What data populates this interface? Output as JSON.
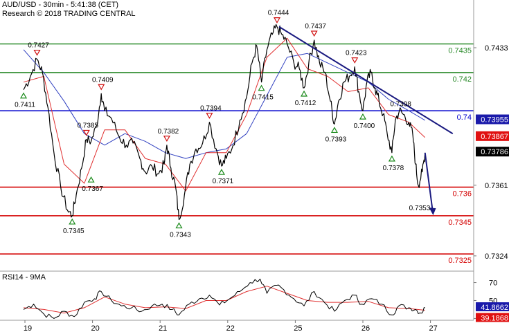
{
  "header": {
    "title": "AUD/USD - 30min - 5:41:38 (CET)",
    "subtitle": "Research © 2018 TRADING CENTRAL"
  },
  "colors": {
    "price": "#000000",
    "support": "#d40000",
    "resistance": "#2a8a2a",
    "pivot": "#0000cc",
    "trendline": "#1a1a80",
    "ma_fast": "#e03030",
    "ma_slow": "#3040c0",
    "rsi": "#000000",
    "rsi_ma": "#e03030",
    "up_marker": "#1a8a1a",
    "down_marker": "#d01010"
  },
  "chart_data": [
    {
      "type": "line",
      "title": "AUD/USD - 30min - 5:41:38 (CET)",
      "ylim": [
        0.7316,
        0.7458
      ],
      "x_ticks": [
        "19",
        "20",
        "21",
        "22",
        "25",
        "26",
        "27"
      ],
      "y_ticks": [
        0.7433,
        0.7361,
        0.7324
      ],
      "last_price": 0.73786,
      "price_labels": [
        {
          "value": 0.73955,
          "color": "#1a1aaa"
        },
        {
          "value": 0.73867,
          "color": "#e01010"
        },
        {
          "value": 0.73786,
          "color": "#000000"
        }
      ],
      "levels": [
        {
          "value": 0.7435,
          "label": "0.7435",
          "kind": "resistance"
        },
        {
          "value": 0.742,
          "label": "0.742",
          "kind": "resistance"
        },
        {
          "value": 0.74,
          "label": "0.74",
          "kind": "pivot"
        },
        {
          "value": 0.736,
          "label": "0.736",
          "kind": "support"
        },
        {
          "value": 0.7345,
          "label": "0.7345",
          "kind": "support"
        },
        {
          "value": 0.7325,
          "label": "0.7325",
          "kind": "support"
        }
      ],
      "price_series": [
        [
          0.0,
          0.7411
        ],
        [
          0.1,
          0.7418
        ],
        [
          0.2,
          0.7427
        ],
        [
          0.28,
          0.742
        ],
        [
          0.36,
          0.7402
        ],
        [
          0.45,
          0.7378
        ],
        [
          0.55,
          0.736
        ],
        [
          0.65,
          0.7348
        ],
        [
          0.72,
          0.7345
        ],
        [
          0.78,
          0.7356
        ],
        [
          0.86,
          0.737
        ],
        [
          0.93,
          0.7385
        ],
        [
          1.0,
          0.7384
        ],
        [
          1.08,
          0.7392
        ],
        [
          1.15,
          0.7409
        ],
        [
          1.2,
          0.74
        ],
        [
          1.3,
          0.7396
        ],
        [
          1.42,
          0.7386
        ],
        [
          1.52,
          0.7382
        ],
        [
          1.62,
          0.7383
        ],
        [
          1.72,
          0.7375
        ],
        [
          1.8,
          0.7368
        ],
        [
          1.9,
          0.7371
        ],
        [
          2.0,
          0.7367
        ],
        [
          2.08,
          0.7372
        ],
        [
          2.12,
          0.7382
        ],
        [
          2.18,
          0.737
        ],
        [
          2.25,
          0.736
        ],
        [
          2.3,
          0.7343
        ],
        [
          2.38,
          0.7356
        ],
        [
          2.46,
          0.7372
        ],
        [
          2.55,
          0.738
        ],
        [
          2.65,
          0.7383
        ],
        [
          2.75,
          0.7394
        ],
        [
          2.85,
          0.738
        ],
        [
          2.93,
          0.7371
        ],
        [
          3.0,
          0.7375
        ],
        [
          3.1,
          0.7382
        ],
        [
          3.2,
          0.7395
        ],
        [
          3.3,
          0.7407
        ],
        [
          3.38,
          0.7425
        ],
        [
          3.45,
          0.7434
        ],
        [
          3.52,
          0.7415
        ],
        [
          3.6,
          0.7432
        ],
        [
          3.68,
          0.744
        ],
        [
          3.75,
          0.7444
        ],
        [
          3.82,
          0.744
        ],
        [
          3.9,
          0.7435
        ],
        [
          4.0,
          0.7425
        ],
        [
          4.08,
          0.7422
        ],
        [
          4.15,
          0.7412
        ],
        [
          4.22,
          0.7425
        ],
        [
          4.3,
          0.7437
        ],
        [
          4.38,
          0.7425
        ],
        [
          4.46,
          0.742
        ],
        [
          4.54,
          0.7405
        ],
        [
          4.6,
          0.7393
        ],
        [
          4.66,
          0.7405
        ],
        [
          4.74,
          0.7415
        ],
        [
          4.82,
          0.7418
        ],
        [
          4.9,
          0.7423
        ],
        [
          4.96,
          0.741
        ],
        [
          5.02,
          0.74
        ],
        [
          5.08,
          0.7415
        ],
        [
          5.14,
          0.742
        ],
        [
          5.2,
          0.7412
        ],
        [
          5.26,
          0.7405
        ],
        [
          5.32,
          0.7398
        ],
        [
          5.38,
          0.7388
        ],
        [
          5.45,
          0.7378
        ],
        [
          5.5,
          0.7395
        ],
        [
          5.56,
          0.74
        ],
        [
          5.62,
          0.7398
        ],
        [
          5.7,
          0.7394
        ],
        [
          5.76,
          0.7387
        ],
        [
          5.8,
          0.7372
        ],
        [
          5.84,
          0.7361
        ],
        [
          5.9,
          0.7368
        ],
        [
          5.94,
          0.7378
        ]
      ],
      "ma_fast": [
        [
          0.0,
          0.7415
        ],
        [
          0.3,
          0.7418
        ],
        [
          0.6,
          0.7372
        ],
        [
          0.9,
          0.7362
        ],
        [
          1.2,
          0.739
        ],
        [
          1.5,
          0.739
        ],
        [
          1.8,
          0.7375
        ],
        [
          2.1,
          0.7372
        ],
        [
          2.4,
          0.7358
        ],
        [
          2.7,
          0.7378
        ],
        [
          3.0,
          0.7378
        ],
        [
          3.3,
          0.7398
        ],
        [
          3.6,
          0.7428
        ],
        [
          3.9,
          0.7438
        ],
        [
          4.2,
          0.7422
        ],
        [
          4.5,
          0.7418
        ],
        [
          4.8,
          0.741
        ],
        [
          5.1,
          0.7412
        ],
        [
          5.4,
          0.7398
        ],
        [
          5.7,
          0.7394
        ],
        [
          5.94,
          0.7386
        ]
      ],
      "ma_slow": [
        [
          0.0,
          0.7432
        ],
        [
          0.3,
          0.742
        ],
        [
          0.6,
          0.7405
        ],
        [
          0.9,
          0.7388
        ],
        [
          1.2,
          0.7382
        ],
        [
          1.5,
          0.7388
        ],
        [
          1.8,
          0.7384
        ],
        [
          2.1,
          0.7378
        ],
        [
          2.4,
          0.7375
        ],
        [
          2.7,
          0.7378
        ],
        [
          3.0,
          0.738
        ],
        [
          3.3,
          0.7388
        ],
        [
          3.6,
          0.7408
        ],
        [
          3.9,
          0.7428
        ],
        [
          4.2,
          0.743
        ],
        [
          4.5,
          0.7425
        ],
        [
          4.8,
          0.742
        ],
        [
          5.1,
          0.7415
        ],
        [
          5.4,
          0.7406
        ],
        [
          5.7,
          0.74
        ],
        [
          5.94,
          0.7395
        ]
      ],
      "trendline": [
        [
          3.78,
          0.7444
        ],
        [
          6.35,
          0.7388
        ]
      ],
      "projection": [
        [
          5.94,
          0.7378
        ],
        [
          6.05,
          0.7346
        ]
      ],
      "markers": [
        {
          "x": 0.0,
          "value": 0.7411,
          "label": "0.7411",
          "dir": "up"
        },
        {
          "x": 0.2,
          "value": 0.7427,
          "label": "0.7427",
          "dir": "down"
        },
        {
          "x": 0.72,
          "value": 0.7345,
          "label": "0.7345",
          "dir": "up"
        },
        {
          "x": 0.93,
          "value": 0.7385,
          "label": "0.7385",
          "dir": "down"
        },
        {
          "x": 1.15,
          "value": 0.7409,
          "label": "0.7409",
          "dir": "down"
        },
        {
          "x": 1.0,
          "value": 0.7367,
          "label": "0.7367",
          "dir": "up"
        },
        {
          "x": 2.12,
          "value": 0.7382,
          "label": "0.7382",
          "dir": "down"
        },
        {
          "x": 2.3,
          "value": 0.7343,
          "label": "0.7343",
          "dir": "up"
        },
        {
          "x": 2.75,
          "value": 0.7394,
          "label": "0.7394",
          "dir": "down"
        },
        {
          "x": 2.93,
          "value": 0.7371,
          "label": "0.7371",
          "dir": "up"
        },
        {
          "x": 3.52,
          "value": 0.7415,
          "label": "0.7415",
          "dir": "up"
        },
        {
          "x": 3.75,
          "value": 0.7444,
          "label": "0.7444",
          "dir": "down"
        },
        {
          "x": 4.15,
          "value": 0.7412,
          "label": "0.7412",
          "dir": "up"
        },
        {
          "x": 4.3,
          "value": 0.7437,
          "label": "0.7437",
          "dir": "down"
        },
        {
          "x": 4.6,
          "value": 0.7393,
          "label": "0.7393",
          "dir": "up"
        },
        {
          "x": 4.9,
          "value": 0.7423,
          "label": "0.7423",
          "dir": "down"
        },
        {
          "x": 5.02,
          "value": 0.74,
          "label": "0.7400",
          "dir": "up"
        },
        {
          "x": 5.45,
          "value": 0.7378,
          "label": "0.7378",
          "dir": "up"
        },
        {
          "x": 5.56,
          "value": 0.7398,
          "label": "0.7398",
          "dir": "none"
        },
        {
          "x": 5.84,
          "value": 0.7353,
          "label": "0.7353",
          "dir": "none"
        }
      ]
    },
    {
      "type": "line",
      "title": "RSI14 - 9MA",
      "ylim": [
        28,
        82
      ],
      "y_ticks": [
        70,
        50,
        30
      ],
      "last_values": {
        "rsi": "41.8662",
        "ma": "39.1868"
      },
      "rsi_series": [
        [
          0.0,
          40
        ],
        [
          0.15,
          46
        ],
        [
          0.3,
          35
        ],
        [
          0.45,
          30
        ],
        [
          0.6,
          38
        ],
        [
          0.75,
          32
        ],
        [
          0.9,
          48
        ],
        [
          1.05,
          52
        ],
        [
          1.15,
          60
        ],
        [
          1.3,
          50
        ],
        [
          1.45,
          44
        ],
        [
          1.6,
          42
        ],
        [
          1.75,
          38
        ],
        [
          1.9,
          44
        ],
        [
          2.05,
          46
        ],
        [
          2.2,
          40
        ],
        [
          2.3,
          34
        ],
        [
          2.45,
          46
        ],
        [
          2.6,
          52
        ],
        [
          2.75,
          56
        ],
        [
          2.9,
          45
        ],
        [
          3.05,
          52
        ],
        [
          3.2,
          60
        ],
        [
          3.35,
          70
        ],
        [
          3.5,
          74
        ],
        [
          3.6,
          58
        ],
        [
          3.75,
          67
        ],
        [
          3.85,
          62
        ],
        [
          4.0,
          52
        ],
        [
          4.15,
          44
        ],
        [
          4.3,
          60
        ],
        [
          4.45,
          48
        ],
        [
          4.6,
          38
        ],
        [
          4.75,
          50
        ],
        [
          4.9,
          56
        ],
        [
          5.0,
          46
        ],
        [
          5.15,
          52
        ],
        [
          5.3,
          46
        ],
        [
          5.45,
          34
        ],
        [
          5.55,
          44
        ],
        [
          5.7,
          42
        ],
        [
          5.8,
          40
        ],
        [
          5.88,
          36
        ],
        [
          5.94,
          41.9
        ]
      ],
      "rsi_ma": [
        [
          0.0,
          42
        ],
        [
          0.3,
          40
        ],
        [
          0.6,
          36
        ],
        [
          0.9,
          42
        ],
        [
          1.2,
          54
        ],
        [
          1.5,
          46
        ],
        [
          1.8,
          42
        ],
        [
          2.1,
          43
        ],
        [
          2.4,
          41
        ],
        [
          2.7,
          50
        ],
        [
          3.0,
          50
        ],
        [
          3.3,
          60
        ],
        [
          3.6,
          66
        ],
        [
          3.9,
          58
        ],
        [
          4.2,
          50
        ],
        [
          4.5,
          48
        ],
        [
          4.8,
          48
        ],
        [
          5.1,
          49
        ],
        [
          5.4,
          42
        ],
        [
          5.7,
          41
        ],
        [
          5.94,
          39.2
        ]
      ]
    }
  ]
}
